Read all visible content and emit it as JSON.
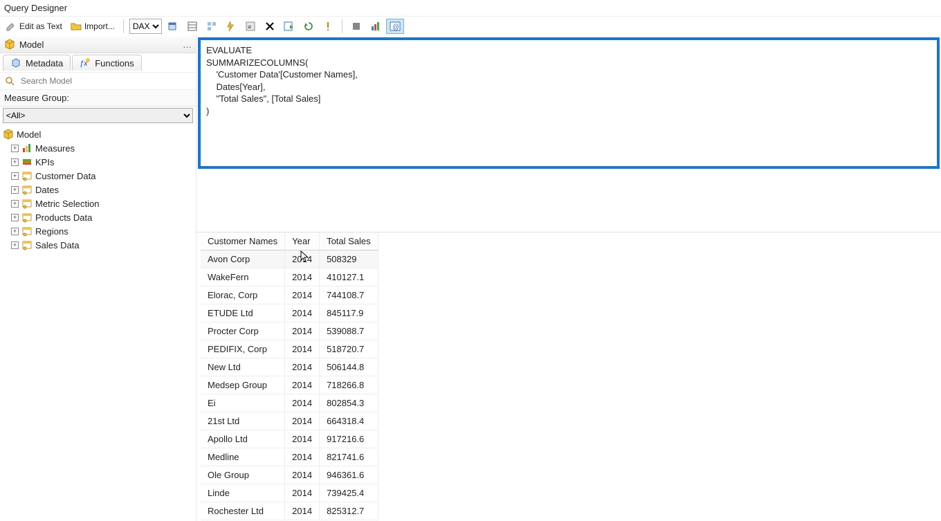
{
  "title": "Query Designer",
  "toolbar": {
    "edit_as_text": "Edit as Text",
    "import": "Import...",
    "cmd_type": "DAX"
  },
  "left": {
    "header": "Model",
    "tabs": {
      "metadata": "Metadata",
      "functions": "Functions"
    },
    "search_placeholder": "Search Model",
    "mg_label": "Measure Group:",
    "mg_value": "<All>",
    "tree_root": "Model",
    "tree_items": [
      {
        "label": "Measures",
        "icon": "measures"
      },
      {
        "label": "KPIs",
        "icon": "kpis"
      },
      {
        "label": "Customer Data",
        "icon": "table"
      },
      {
        "label": "Dates",
        "icon": "table"
      },
      {
        "label": "Metric Selection",
        "icon": "table"
      },
      {
        "label": "Products Data",
        "icon": "table"
      },
      {
        "label": "Regions",
        "icon": "table"
      },
      {
        "label": "Sales Data",
        "icon": "table"
      }
    ]
  },
  "query_lines": [
    "EVALUATE",
    "SUMMARIZECOLUMNS(",
    "    'Customer Data'[Customer Names],",
    "    Dates[Year],",
    "    \"Total Sales\", [Total Sales]",
    ")"
  ],
  "results": {
    "columns": [
      "Customer Names",
      "Year",
      "Total Sales"
    ],
    "rows": [
      [
        "Avon Corp",
        "2014",
        "508329"
      ],
      [
        "WakeFern",
        "2014",
        "410127.1"
      ],
      [
        "Elorac, Corp",
        "2014",
        "744108.7"
      ],
      [
        "ETUDE Ltd",
        "2014",
        "845117.9"
      ],
      [
        "Procter Corp",
        "2014",
        "539088.7"
      ],
      [
        "PEDIFIX, Corp",
        "2014",
        "518720.7"
      ],
      [
        "New Ltd",
        "2014",
        "506144.8"
      ],
      [
        "Medsep Group",
        "2014",
        "718266.8"
      ],
      [
        "Ei",
        "2014",
        "802854.3"
      ],
      [
        "21st Ltd",
        "2014",
        "664318.4"
      ],
      [
        "Apollo Ltd",
        "2014",
        "917216.6"
      ],
      [
        "Medline",
        "2014",
        "821741.6"
      ],
      [
        "Ole Group",
        "2014",
        "946361.6"
      ],
      [
        "Linde",
        "2014",
        "739425.4"
      ],
      [
        "Rochester Ltd",
        "2014",
        "825312.7"
      ]
    ]
  },
  "icons": {
    "cube": "cube-icon",
    "metadata": "cube-outline-icon",
    "functions": "fx-icon"
  }
}
